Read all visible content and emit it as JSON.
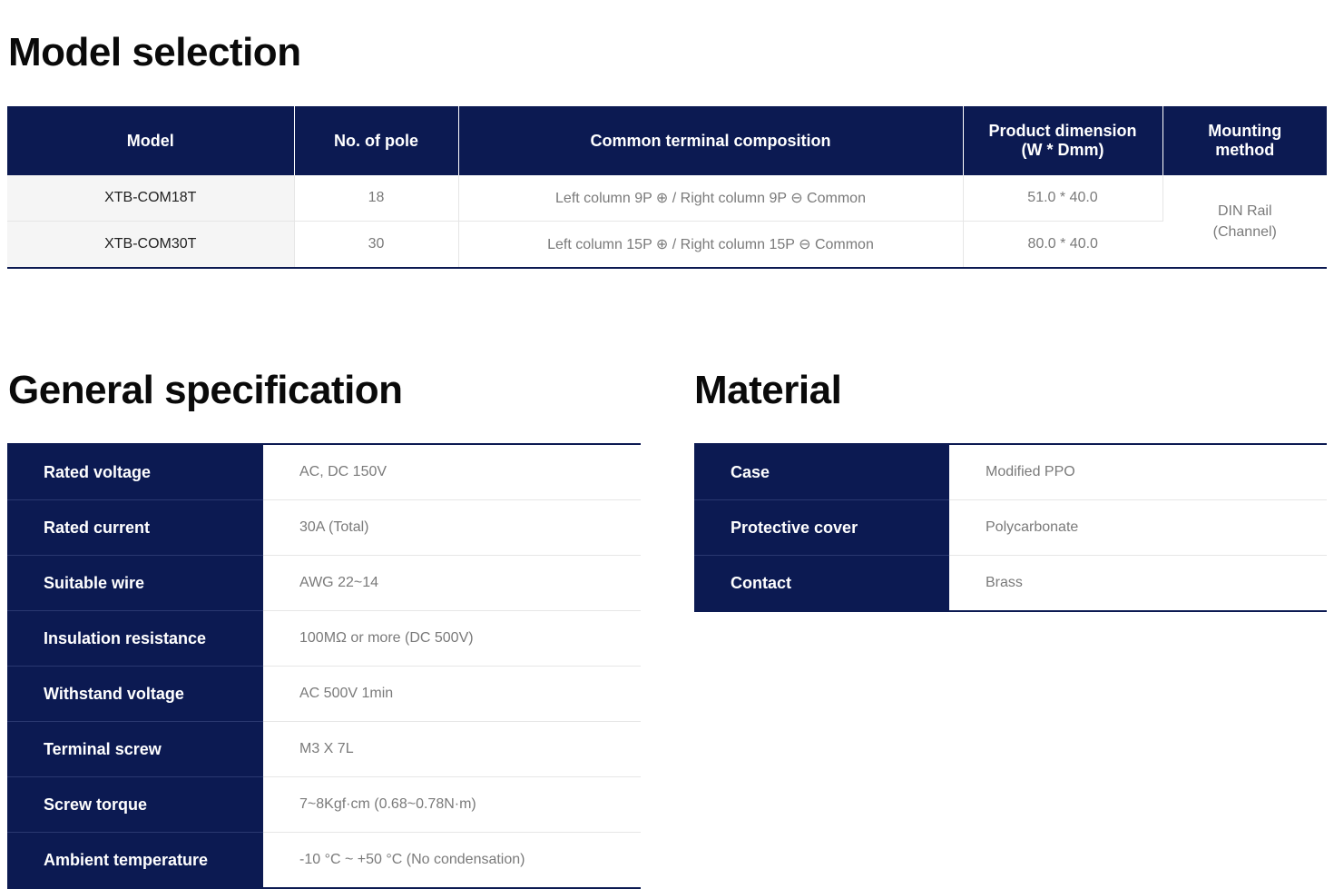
{
  "model_selection": {
    "title": "Model selection",
    "headers": [
      "Model",
      "No. of pole",
      "Common terminal composition",
      "Product dimension\n(W * Dmm)",
      "Mounting\nmethod"
    ],
    "rows": [
      {
        "model": "XTB-COM18T",
        "poles": "18",
        "composition": "Left column 9P ⊕ / Right column 9P ⊖ Common",
        "dimension": "51.0 * 40.0"
      },
      {
        "model": "XTB-COM30T",
        "poles": "30",
        "composition": "Left column 15P ⊕ / Right column 15P ⊖ Common",
        "dimension": "80.0 * 40.0"
      }
    ],
    "mounting": "DIN Rail\n(Channel)"
  },
  "general_specification": {
    "title": "General specification",
    "rows": [
      {
        "label": "Rated voltage",
        "value": "AC, DC 150V"
      },
      {
        "label": "Rated current",
        "value": "30A (Total)"
      },
      {
        "label": "Suitable wire",
        "value": "AWG 22~14"
      },
      {
        "label": "Insulation resistance",
        "value": "100MΩ or more (DC 500V)"
      },
      {
        "label": "Withstand voltage",
        "value": "AC 500V 1min"
      },
      {
        "label": "Terminal screw",
        "value": "M3 X 7L"
      },
      {
        "label": "Screw torque",
        "value": "7~8Kgf·cm (0.68~0.78N·m)"
      },
      {
        "label": "Ambient temperature",
        "value": "-10 °C ~ +50 °C (No condensation)"
      }
    ]
  },
  "material": {
    "title": "Material",
    "rows": [
      {
        "label": "Case",
        "value": "Modified PPO"
      },
      {
        "label": "Protective cover",
        "value": "Polycarbonate"
      },
      {
        "label": "Contact",
        "value": "Brass"
      }
    ]
  }
}
